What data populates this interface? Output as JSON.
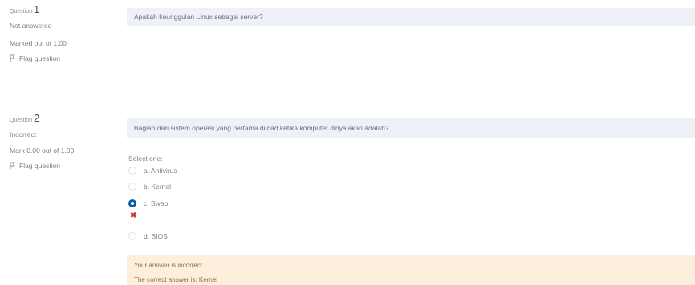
{
  "question1": {
    "label": "Question",
    "number": "1",
    "status": "Not answered",
    "marks": "Marked out of 1.00",
    "flag_label": "Flag question",
    "text": "Apakah keunggulan Linux sebagai server?"
  },
  "question2": {
    "label": "Question",
    "number": "2",
    "status": "Incorrect",
    "marks": "Mark 0.00 out of 1.00",
    "flag_label": "Flag question",
    "text": "Bagian dari sistem operasi yang pertama diload ketika komputer dinyalakan adalah?",
    "select_label": "Select one:",
    "options": [
      {
        "label": "a. Antivirus",
        "checked": false
      },
      {
        "label": "b. Kernel",
        "checked": false
      },
      {
        "label": "c. Swap",
        "checked": true
      },
      {
        "label": "d. BIOS",
        "checked": false
      }
    ],
    "feedback_incorrect": "Your answer is incorrect.",
    "feedback_correct": "The correct answer is: Kernel"
  },
  "colors": {
    "accent": "#0f5aa8",
    "question_bg": "#eef1f5",
    "feedback_bg": "#fcefdc",
    "incorrect_mark": "#c0392b"
  }
}
